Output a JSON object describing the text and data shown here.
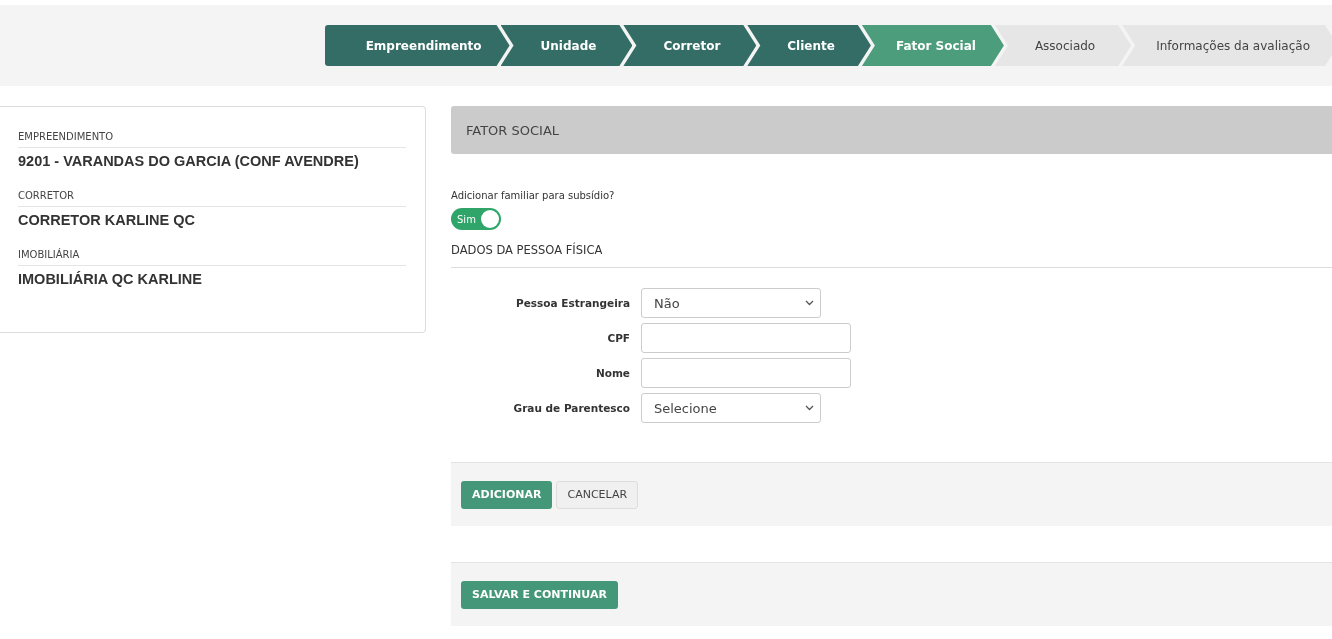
{
  "steps": [
    {
      "label": "Empreendimento",
      "done": true,
      "selected": false
    },
    {
      "label": "Unidade",
      "done": true,
      "selected": false
    },
    {
      "label": "Corretor",
      "done": true,
      "selected": false
    },
    {
      "label": "Cliente",
      "done": true,
      "selected": false
    },
    {
      "label": "Fator Social",
      "done": false,
      "selected": true
    },
    {
      "label": "Associado",
      "done": false,
      "selected": false
    },
    {
      "label": "Informações da avaliação",
      "done": false,
      "selected": false
    }
  ],
  "summary": [
    {
      "label": "EMPREENDIMENTO",
      "value": "9201 - VARANDAS DO GARCIA (CONF AVENDRE)"
    },
    {
      "label": "CORRETOR",
      "value": "CORRETOR KARLINE QC"
    },
    {
      "label": "IMOBILIÁRIA",
      "value": "IMOBILIÁRIA QC KARLINE"
    }
  ],
  "panel": {
    "title": "FATOR SOCIAL",
    "toggle": {
      "label": "Adicionar familiar para subsídio?",
      "on_text": "Sim",
      "on": true
    },
    "section_title": "DADOS DA PESSOA FÍSICA",
    "fields": [
      {
        "kind": "select",
        "label": "Pessoa Estrangeira",
        "value": "Não"
      },
      {
        "kind": "text",
        "label": "CPF"
      },
      {
        "kind": "text",
        "label": "Nome"
      },
      {
        "kind": "select",
        "label": "Grau de Parentesco",
        "value": "Selecione"
      }
    ],
    "add_button": "ADICIONAR",
    "cancel_button": "CANCELAR"
  },
  "save_button": "SALVAR E CONTINUAR"
}
